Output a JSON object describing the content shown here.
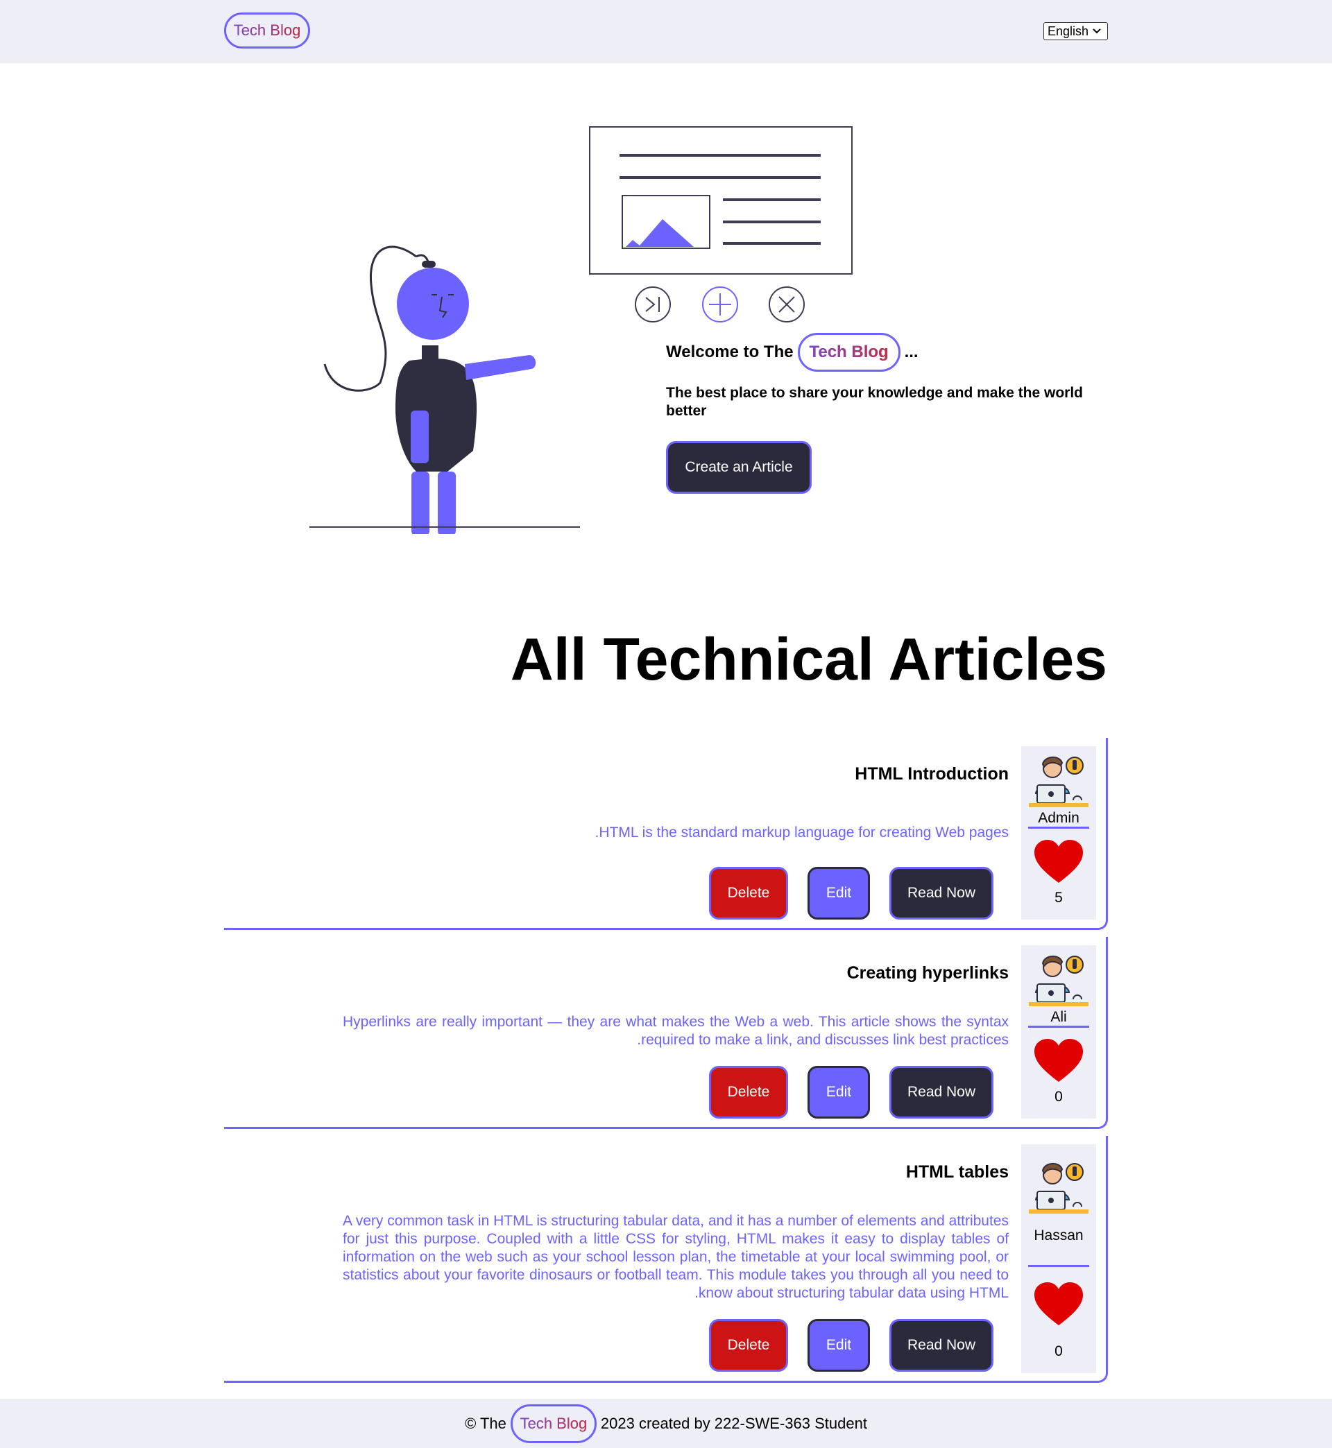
{
  "header": {
    "brand": "Tech Blog",
    "language": "English"
  },
  "hero": {
    "welcome_prefix": "Welcome to The",
    "welcome_brand": "Tech Blog",
    "welcome_suffix": "...",
    "tagline": "The best place to share your knowledge and make the world better",
    "cta_label": "Create an Article"
  },
  "section_title": "All Technical Articles",
  "articles": [
    {
      "title": "HTML Introduction",
      "description": "HTML is the standard markup language for creating Web pages.",
      "author": "Admin",
      "likes": "5",
      "delete_label": "Delete",
      "edit_label": "Edit",
      "read_label": "Read Now"
    },
    {
      "title": "Creating hyperlinks",
      "description": "Hyperlinks are really important — they are what makes the Web a web. This article shows the syntax required to make a link, and discusses link best practices.",
      "author": "Ali",
      "likes": "0",
      "delete_label": "Delete",
      "edit_label": "Edit",
      "read_label": "Read Now"
    },
    {
      "title": "HTML tables",
      "description": "A very common task in HTML is structuring tabular data, and it has a number of elements and attributes for just this purpose. Coupled with a little CSS for styling, HTML makes it easy to display tables of information on the web such as your school lesson plan, the timetable at your local swimming pool, or statistics about your favorite dinosaurs or football team. This module takes you through all you need to know about structuring tabular data using HTML.",
      "author": "Hassan",
      "likes": "0",
      "delete_label": "Delete",
      "edit_label": "Edit",
      "read_label": "Read Now"
    }
  ],
  "footer": {
    "prefix": "© The",
    "brand": "Tech Blog",
    "suffix": "2023 created by 222-SWE-363 Student"
  },
  "colors": {
    "accent": "#6c63ff",
    "dark": "#2b2a3c",
    "danger": "#cc1414",
    "panel": "#eeeef7"
  }
}
